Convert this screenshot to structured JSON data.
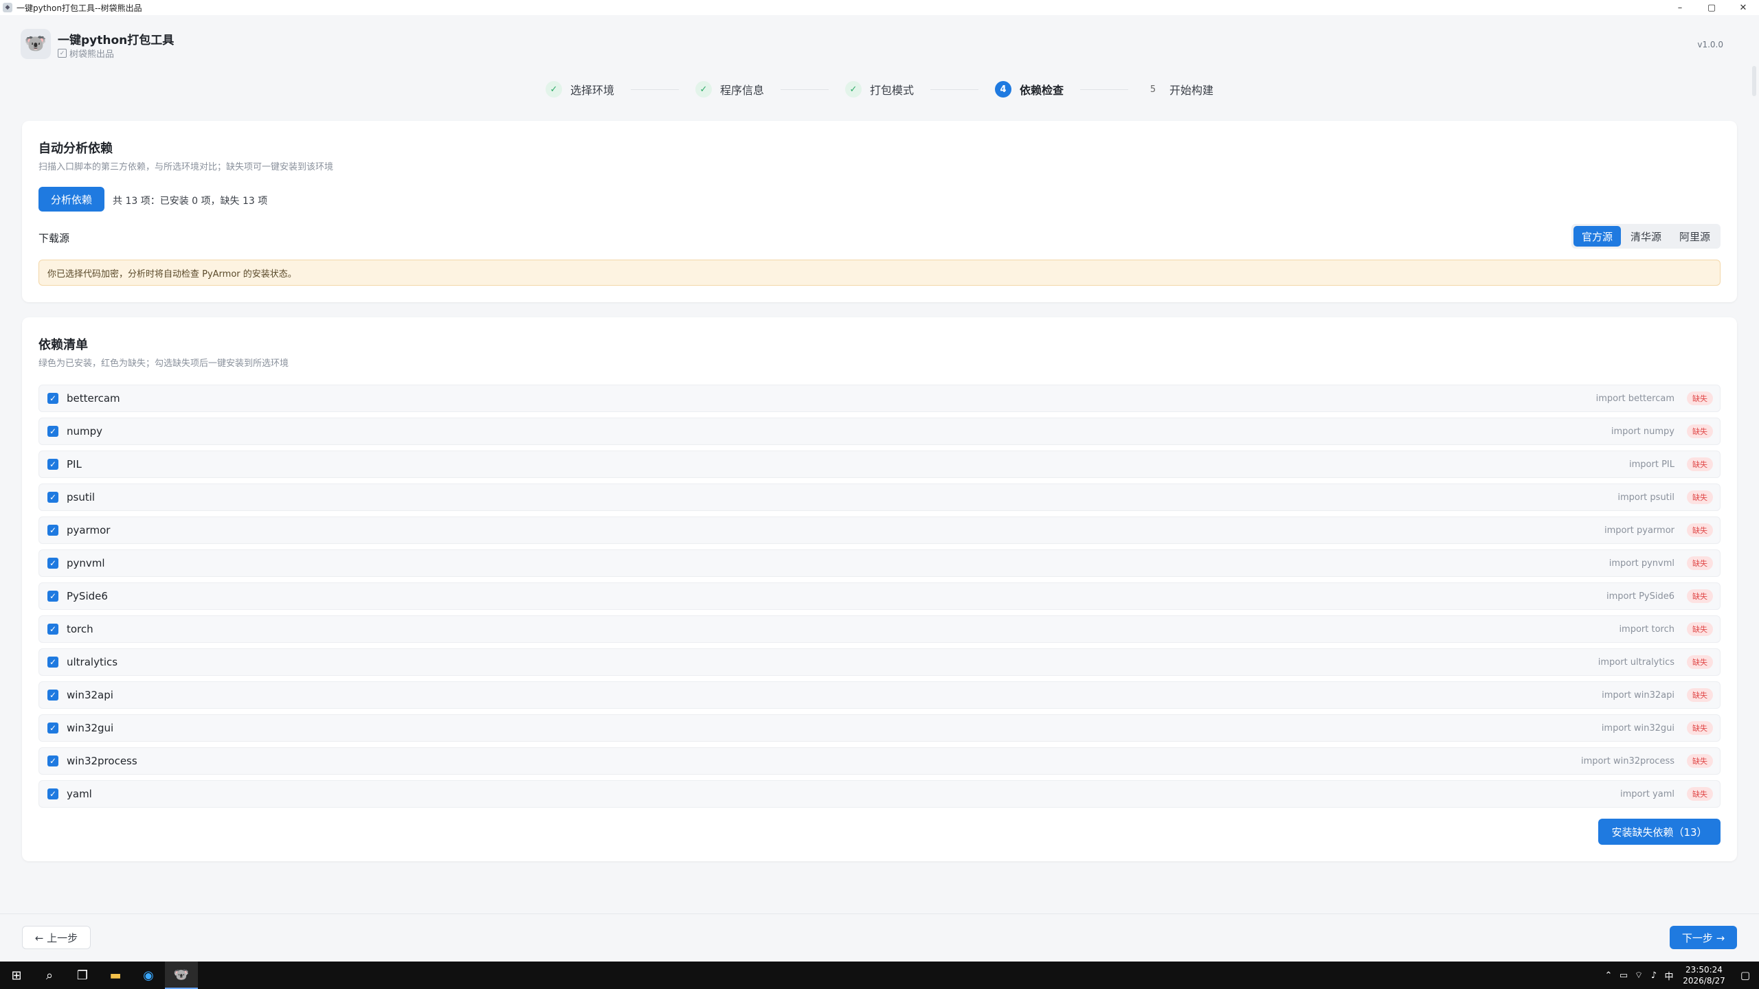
{
  "window": {
    "title": "一键python打包工具--树袋熊出品",
    "controls": {
      "minimize": "–",
      "maximize": "▢",
      "close": "✕"
    }
  },
  "header": {
    "app_name": "一键python打包工具",
    "subtitle": "树袋熊出品",
    "version": "v1.0.0"
  },
  "steps": [
    {
      "label": "选择环境",
      "state": "done",
      "mark": "✓"
    },
    {
      "label": "程序信息",
      "state": "done",
      "mark": "✓"
    },
    {
      "label": "打包模式",
      "state": "done",
      "mark": "✓"
    },
    {
      "label": "依赖检查",
      "state": "active",
      "mark": "4"
    },
    {
      "label": "开始构建",
      "state": "todo",
      "mark": "5"
    }
  ],
  "analysis": {
    "title": "自动分析依赖",
    "description": "扫描入口脚本的第三方依赖，与所选环境对比；缺失项可一键安装到该环境",
    "analyze_button": "分析依赖",
    "summary": "共 13 项：已安装 0 项，缺失 13 项",
    "source_label": "下载源",
    "sources": [
      "官方源",
      "清华源",
      "阿里源"
    ],
    "selected_source": "官方源",
    "warning": "你已选择代码加密，分析时将自动检查 PyArmor 的安装状态。"
  },
  "deps": {
    "title": "依赖清单",
    "description": "绿色为已安装，红色为缺失；勾选缺失项后一键安装到所选环境",
    "missing_label": "缺失",
    "items": [
      {
        "name": "bettercam",
        "import": "import bettercam"
      },
      {
        "name": "numpy",
        "import": "import numpy"
      },
      {
        "name": "PIL",
        "import": "import PIL"
      },
      {
        "name": "psutil",
        "import": "import psutil"
      },
      {
        "name": "pyarmor",
        "import": "import pyarmor"
      },
      {
        "name": "pynvml",
        "import": "import pynvml"
      },
      {
        "name": "PySide6",
        "import": "import PySide6"
      },
      {
        "name": "torch",
        "import": "import torch"
      },
      {
        "name": "ultralytics",
        "import": "import ultralytics"
      },
      {
        "name": "win32api",
        "import": "import win32api"
      },
      {
        "name": "win32gui",
        "import": "import win32gui"
      },
      {
        "name": "win32process",
        "import": "import win32process"
      },
      {
        "name": "yaml",
        "import": "import yaml"
      }
    ],
    "install_button": "安装缺失依赖（13）"
  },
  "footer": {
    "prev": "← 上一步",
    "next": "下一步 →"
  },
  "taskbar": {
    "time": "23:50:24",
    "date": "2026/8/27",
    "ime": "中"
  }
}
